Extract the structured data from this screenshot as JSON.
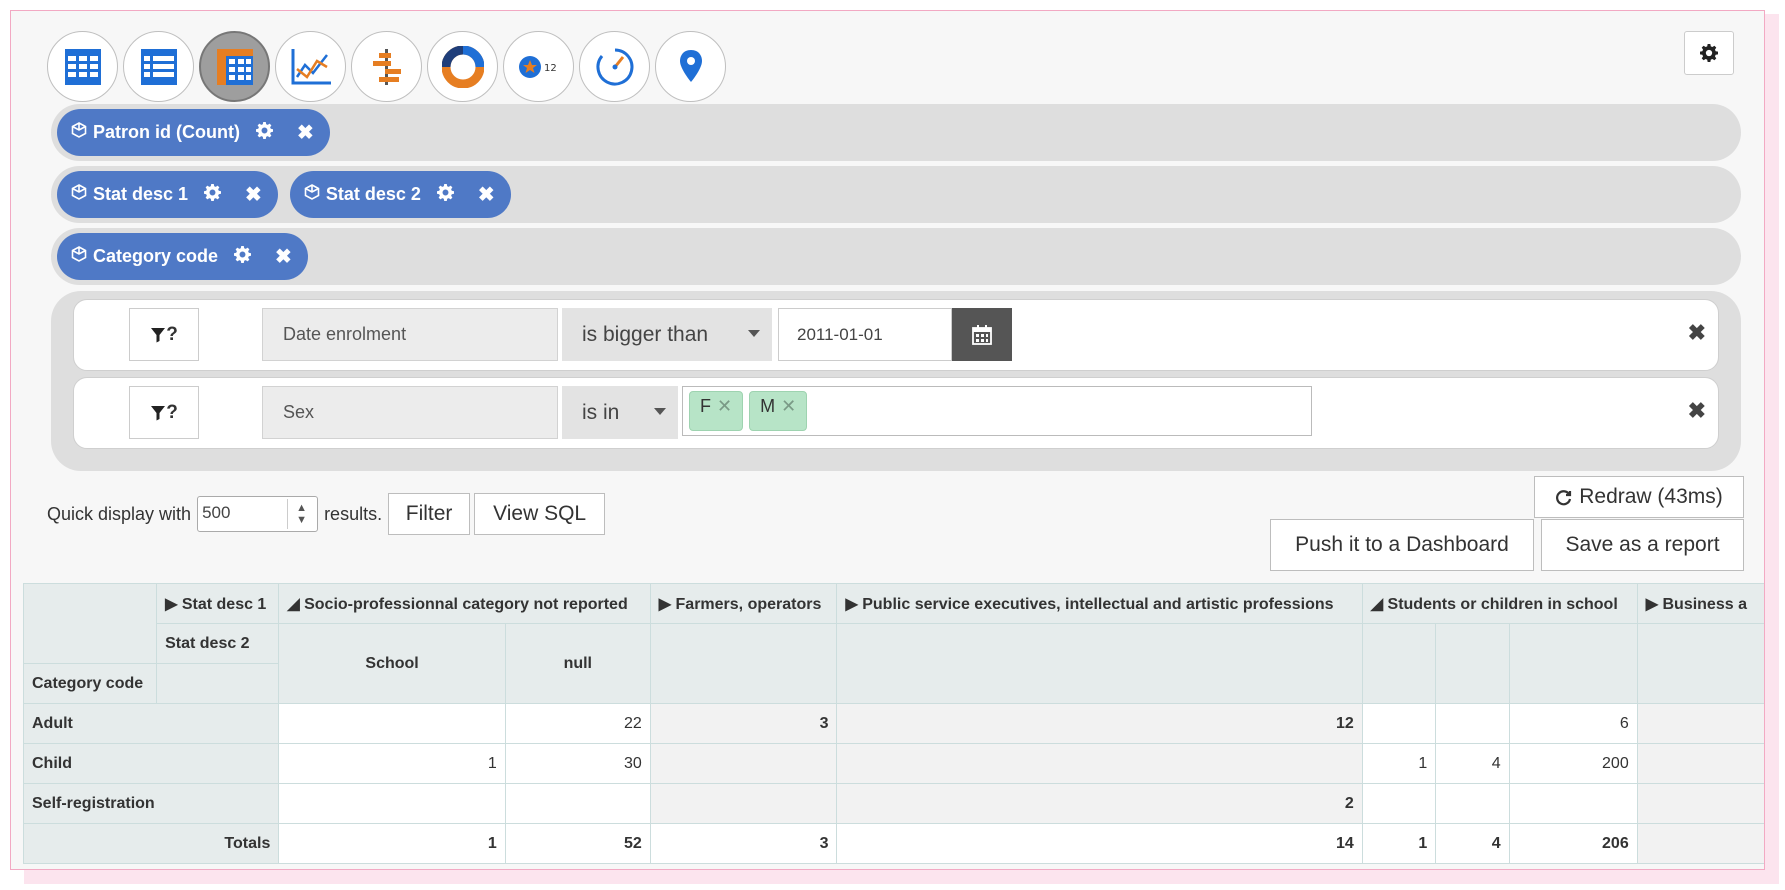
{
  "toolbar": {
    "chart_types": [
      {
        "icon": "table-icon",
        "active": false
      },
      {
        "icon": "list-table-icon",
        "active": false
      },
      {
        "icon": "pivot-table-icon",
        "active": true
      },
      {
        "icon": "line-chart-icon",
        "active": false
      },
      {
        "icon": "bar-chart-icon",
        "active": false
      },
      {
        "icon": "donut-chart-icon",
        "active": false
      },
      {
        "icon": "number-badge-icon",
        "active": false,
        "badge": "12"
      },
      {
        "icon": "gauge-icon",
        "active": false
      },
      {
        "icon": "map-marker-icon",
        "active": false
      }
    ],
    "settings_icon": "gear-icon"
  },
  "zones": {
    "values": [
      {
        "label": "Patron id (Count)"
      }
    ],
    "columns": [
      {
        "label": "Stat desc 1"
      },
      {
        "label": "Stat desc 2"
      }
    ],
    "rows": [
      {
        "label": "Category code"
      }
    ]
  },
  "filters": [
    {
      "funnel_label": "?",
      "field": "Date enrolment",
      "operator": "is bigger than",
      "value": "2011-01-01"
    },
    {
      "funnel_label": "?",
      "field": "Sex",
      "operator": "is in",
      "tags": [
        "F",
        "M"
      ]
    }
  ],
  "controls": {
    "quick_display_prefix": "Quick display with",
    "quick_display_value": "500",
    "quick_display_suffix": "results.",
    "filter_label": "Filter",
    "view_sql_label": "View SQL",
    "redraw_label": "Redraw (43ms)",
    "push_dashboard_label": "Push it to a Dashboard",
    "save_report_label": "Save as a report"
  },
  "pivot": {
    "col_attr_1": "▶ Stat desc 1",
    "col_attr_2": "Stat desc 2",
    "row_attr": "Category code",
    "groups": [
      "◢ Socio-professionnal category not reported",
      "▶ Farmers, operators",
      "▶ Public service executives, intellectual and artistic professions",
      "◢ Students or children in school",
      "▶ Business a"
    ],
    "sub_headers": [
      "School",
      "null"
    ],
    "rows": [
      {
        "label": "Adult",
        "cells": [
          "",
          "22",
          "3",
          "12",
          "",
          "",
          "6",
          ""
        ]
      },
      {
        "label": "Child",
        "cells": [
          "1",
          "30",
          "",
          "",
          "1",
          "4",
          "200",
          ""
        ]
      },
      {
        "label": "Self-registration",
        "cells": [
          "",
          "",
          "",
          "2",
          "",
          "",
          "",
          ""
        ]
      }
    ],
    "totals_label": "Totals",
    "totals": [
      "1",
      "52",
      "3",
      "14",
      "1",
      "4",
      "206",
      ""
    ]
  }
}
